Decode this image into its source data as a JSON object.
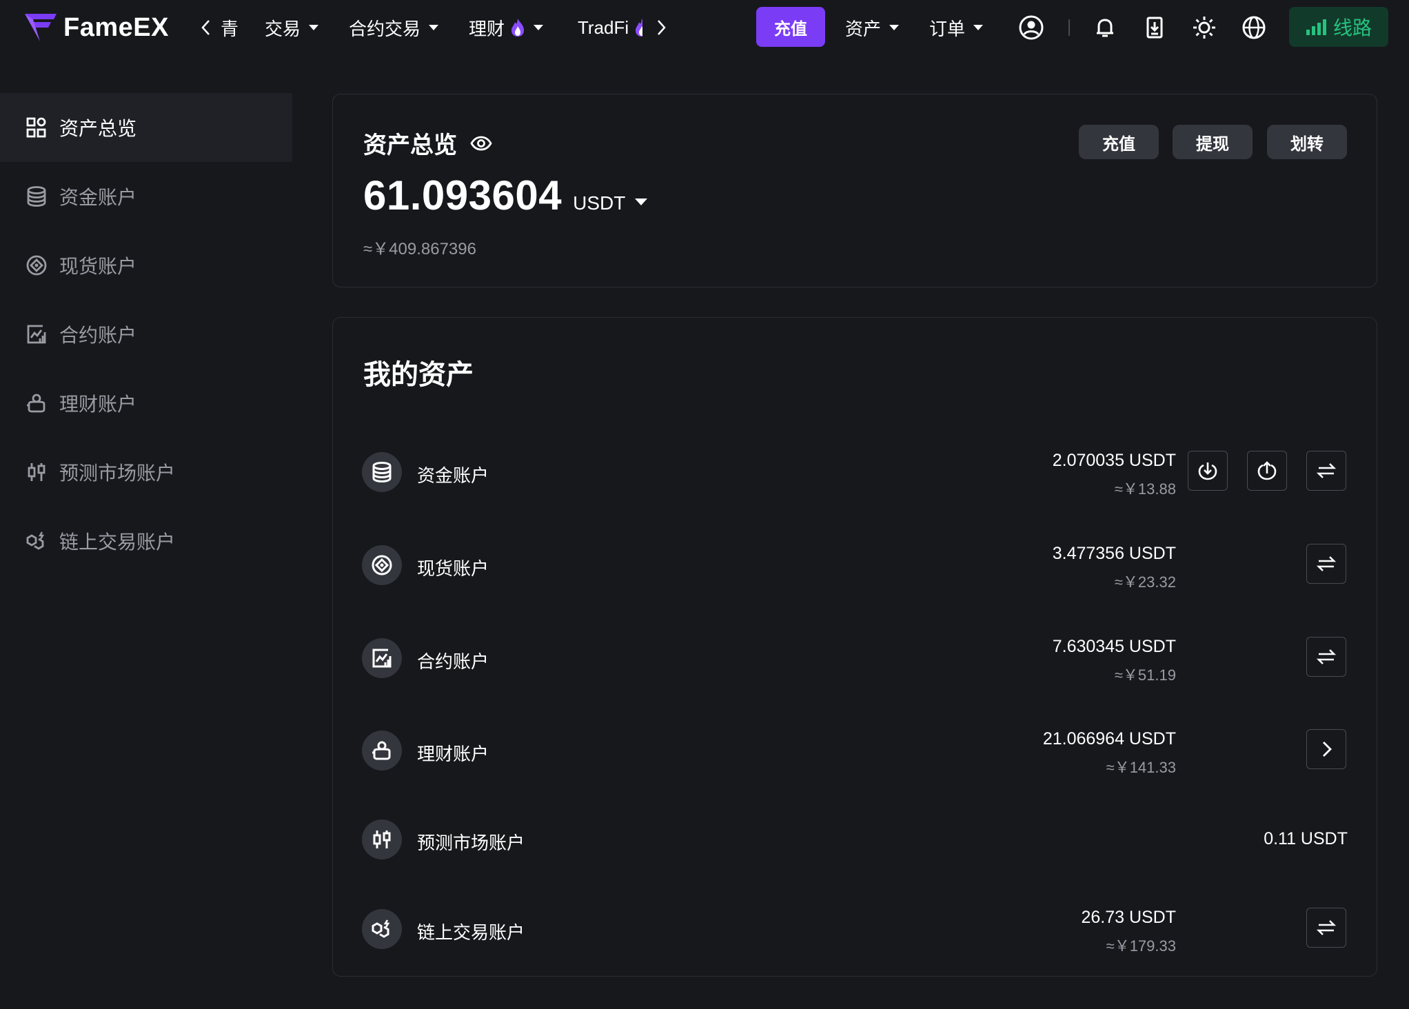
{
  "brand": {
    "name": "FameEX",
    "accent": "#7b3cf6"
  },
  "nav": {
    "partial_item": "青",
    "items": [
      {
        "label": "交易",
        "has_caret": true
      },
      {
        "label": "合约交易",
        "has_caret": true
      },
      {
        "label": "理财",
        "has_caret": true,
        "icon": "fire-icon"
      },
      {
        "label": "TradFi",
        "has_caret": false,
        "icon": "fire-icon"
      }
    ],
    "deposit_button": "充值",
    "assets_menu": "资产",
    "orders_menu": "订单",
    "line_button": "线路",
    "icons": [
      "user-icon",
      "bell-icon",
      "download-app-icon",
      "theme-sun-icon",
      "globe-icon",
      "signal-icon"
    ]
  },
  "sidebar": {
    "items": [
      {
        "label": "资产总览",
        "icon": "grid-icon",
        "active": true
      },
      {
        "label": "资金账户",
        "icon": "database-icon",
        "active": false
      },
      {
        "label": "现货账户",
        "icon": "spot-icon",
        "active": false
      },
      {
        "label": "合约账户",
        "icon": "chart-icon",
        "active": false
      },
      {
        "label": "理财账户",
        "icon": "piggy-icon",
        "active": false
      },
      {
        "label": "预测市场账户",
        "icon": "candles-icon",
        "active": false
      },
      {
        "label": "链上交易账户",
        "icon": "chain-icon",
        "active": false
      }
    ]
  },
  "overview": {
    "title": "资产总览",
    "total": "61.093604",
    "unit": "USDT",
    "cny": "≈￥409.867396",
    "buttons": {
      "deposit": "充值",
      "withdraw": "提现",
      "transfer": "划转"
    }
  },
  "my_assets": {
    "title": "我的资产",
    "rows": [
      {
        "name": "资金账户",
        "amount": "2.070035 USDT",
        "cny": "≈￥13.88",
        "icon": "database-icon"
      },
      {
        "name": "现货账户",
        "amount": "3.477356 USDT",
        "cny": "≈￥23.32",
        "icon": "spot-icon"
      },
      {
        "name": "合约账户",
        "amount": "7.630345 USDT",
        "cny": "≈￥51.19",
        "icon": "chart-icon"
      },
      {
        "name": "理财账户",
        "amount": "21.066964 USDT",
        "cny": "≈￥141.33",
        "icon": "piggy-icon"
      },
      {
        "name": "预测市场账户",
        "amount": "0.11 USDT",
        "cny": "",
        "icon": "candles-icon"
      },
      {
        "name": "链上交易账户",
        "amount": "26.73 USDT",
        "cny": "≈￥179.33",
        "icon": "chain-icon"
      }
    ]
  },
  "colors": {
    "background": "#17181c",
    "card_border": "#2c2d34",
    "muted": "#9a9ba3",
    "line_green": "#26c281"
  }
}
